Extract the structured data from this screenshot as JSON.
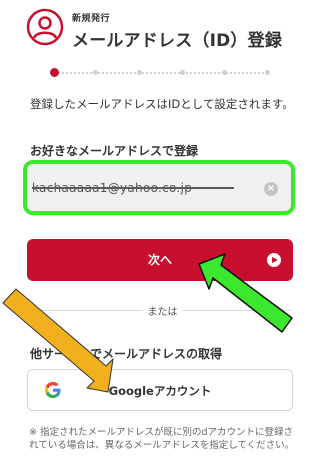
{
  "header": {
    "eyebrow": "新規発行",
    "title": "メールアドレス（ID）登録"
  },
  "stepper": {
    "total_steps": 7,
    "current_step": 1
  },
  "description": "登録したメールアドレスはIDとして設定されます。",
  "email_section": {
    "label": "お好きなメールアドレスで登録",
    "value": "kachaaaaa1@yahoo.co.jp",
    "clear_icon": "×"
  },
  "next_button": {
    "label": "次へ"
  },
  "divider": {
    "label": "または"
  },
  "other_service": {
    "heading": "他サービスでメールアドレスの取得",
    "google_button_label": "Googleアカウント"
  },
  "footnote": "※ 指定されたメールアドレスが既に別のdアカウントに登録されている場合は、異なるメールアドレスを指定してください。",
  "colors": {
    "brand_red": "#c8102e",
    "highlight_green": "#3be82e",
    "arrow_yellow": "#f2b01e"
  }
}
